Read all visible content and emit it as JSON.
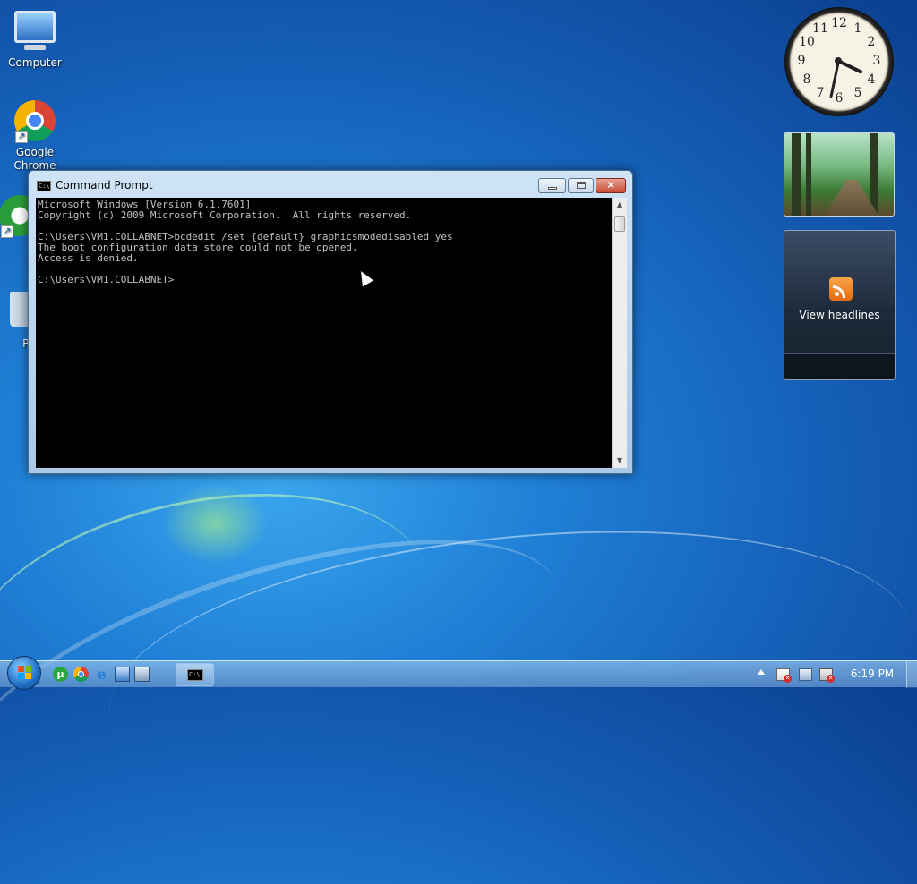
{
  "desktop": {
    "icons": [
      {
        "label": "Computer"
      },
      {
        "label": "Google Chrome"
      },
      {
        "label": "µT"
      },
      {
        "label": "Recy"
      }
    ]
  },
  "cmd": {
    "title": "Command Prompt",
    "output": "Microsoft Windows [Version 6.1.7601]\nCopyright (c) 2009 Microsoft Corporation.  All rights reserved.\n\nC:\\Users\\VM1.COLLABNET>bcdedit /set {default} graphicsmodedisabled yes\nThe boot configuration data store could not be opened.\nAccess is denied.\n\nC:\\Users\\VM1.COLLABNET>",
    "icon": "cmd-icon"
  },
  "gadgets": {
    "clock_numbers": [
      "12",
      "1",
      "2",
      "3",
      "4",
      "5",
      "6",
      "7",
      "8",
      "9",
      "10",
      "11"
    ],
    "feed_label": "View headlines"
  },
  "taskbar": {
    "pinned": [
      {
        "icon": "utorrent-icon"
      },
      {
        "icon": "chrome-icon"
      },
      {
        "icon": "internet-explorer-icon"
      },
      {
        "icon": "windows-explorer-icon"
      },
      {
        "icon": "remote-desktop-icon"
      }
    ],
    "active_task": "cmd-icon",
    "time": "6:19 PM"
  },
  "colors": {
    "console_bg": "#000000",
    "console_fg": "#c0c0c0",
    "desktop_blue": "#1f7fd6"
  }
}
